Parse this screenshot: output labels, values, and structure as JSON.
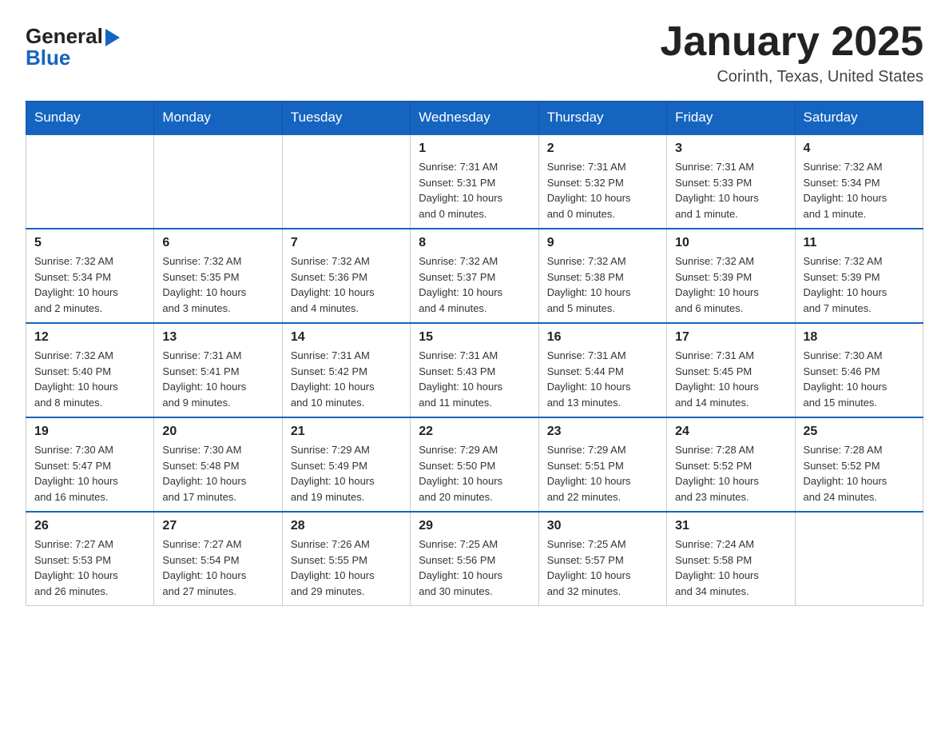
{
  "header": {
    "title": "January 2025",
    "location": "Corinth, Texas, United States"
  },
  "logo": {
    "line1": "General",
    "line2": "Blue"
  },
  "days": [
    "Sunday",
    "Monday",
    "Tuesday",
    "Wednesday",
    "Thursday",
    "Friday",
    "Saturday"
  ],
  "weeks": [
    [
      {
        "day": "",
        "sunrise": "",
        "sunset": "",
        "daylight": ""
      },
      {
        "day": "",
        "sunrise": "",
        "sunset": "",
        "daylight": ""
      },
      {
        "day": "",
        "sunrise": "",
        "sunset": "",
        "daylight": ""
      },
      {
        "day": "1",
        "sunrise": "Sunrise: 7:31 AM",
        "sunset": "Sunset: 5:31 PM",
        "daylight": "Daylight: 10 hours and 0 minutes."
      },
      {
        "day": "2",
        "sunrise": "Sunrise: 7:31 AM",
        "sunset": "Sunset: 5:32 PM",
        "daylight": "Daylight: 10 hours and 0 minutes."
      },
      {
        "day": "3",
        "sunrise": "Sunrise: 7:31 AM",
        "sunset": "Sunset: 5:33 PM",
        "daylight": "Daylight: 10 hours and 1 minute."
      },
      {
        "day": "4",
        "sunrise": "Sunrise: 7:32 AM",
        "sunset": "Sunset: 5:34 PM",
        "daylight": "Daylight: 10 hours and 1 minute."
      }
    ],
    [
      {
        "day": "5",
        "sunrise": "Sunrise: 7:32 AM",
        "sunset": "Sunset: 5:34 PM",
        "daylight": "Daylight: 10 hours and 2 minutes."
      },
      {
        "day": "6",
        "sunrise": "Sunrise: 7:32 AM",
        "sunset": "Sunset: 5:35 PM",
        "daylight": "Daylight: 10 hours and 3 minutes."
      },
      {
        "day": "7",
        "sunrise": "Sunrise: 7:32 AM",
        "sunset": "Sunset: 5:36 PM",
        "daylight": "Daylight: 10 hours and 4 minutes."
      },
      {
        "day": "8",
        "sunrise": "Sunrise: 7:32 AM",
        "sunset": "Sunset: 5:37 PM",
        "daylight": "Daylight: 10 hours and 4 minutes."
      },
      {
        "day": "9",
        "sunrise": "Sunrise: 7:32 AM",
        "sunset": "Sunset: 5:38 PM",
        "daylight": "Daylight: 10 hours and 5 minutes."
      },
      {
        "day": "10",
        "sunrise": "Sunrise: 7:32 AM",
        "sunset": "Sunset: 5:39 PM",
        "daylight": "Daylight: 10 hours and 6 minutes."
      },
      {
        "day": "11",
        "sunrise": "Sunrise: 7:32 AM",
        "sunset": "Sunset: 5:39 PM",
        "daylight": "Daylight: 10 hours and 7 minutes."
      }
    ],
    [
      {
        "day": "12",
        "sunrise": "Sunrise: 7:32 AM",
        "sunset": "Sunset: 5:40 PM",
        "daylight": "Daylight: 10 hours and 8 minutes."
      },
      {
        "day": "13",
        "sunrise": "Sunrise: 7:31 AM",
        "sunset": "Sunset: 5:41 PM",
        "daylight": "Daylight: 10 hours and 9 minutes."
      },
      {
        "day": "14",
        "sunrise": "Sunrise: 7:31 AM",
        "sunset": "Sunset: 5:42 PM",
        "daylight": "Daylight: 10 hours and 10 minutes."
      },
      {
        "day": "15",
        "sunrise": "Sunrise: 7:31 AM",
        "sunset": "Sunset: 5:43 PM",
        "daylight": "Daylight: 10 hours and 11 minutes."
      },
      {
        "day": "16",
        "sunrise": "Sunrise: 7:31 AM",
        "sunset": "Sunset: 5:44 PM",
        "daylight": "Daylight: 10 hours and 13 minutes."
      },
      {
        "day": "17",
        "sunrise": "Sunrise: 7:31 AM",
        "sunset": "Sunset: 5:45 PM",
        "daylight": "Daylight: 10 hours and 14 minutes."
      },
      {
        "day": "18",
        "sunrise": "Sunrise: 7:30 AM",
        "sunset": "Sunset: 5:46 PM",
        "daylight": "Daylight: 10 hours and 15 minutes."
      }
    ],
    [
      {
        "day": "19",
        "sunrise": "Sunrise: 7:30 AM",
        "sunset": "Sunset: 5:47 PM",
        "daylight": "Daylight: 10 hours and 16 minutes."
      },
      {
        "day": "20",
        "sunrise": "Sunrise: 7:30 AM",
        "sunset": "Sunset: 5:48 PM",
        "daylight": "Daylight: 10 hours and 17 minutes."
      },
      {
        "day": "21",
        "sunrise": "Sunrise: 7:29 AM",
        "sunset": "Sunset: 5:49 PM",
        "daylight": "Daylight: 10 hours and 19 minutes."
      },
      {
        "day": "22",
        "sunrise": "Sunrise: 7:29 AM",
        "sunset": "Sunset: 5:50 PM",
        "daylight": "Daylight: 10 hours and 20 minutes."
      },
      {
        "day": "23",
        "sunrise": "Sunrise: 7:29 AM",
        "sunset": "Sunset: 5:51 PM",
        "daylight": "Daylight: 10 hours and 22 minutes."
      },
      {
        "day": "24",
        "sunrise": "Sunrise: 7:28 AM",
        "sunset": "Sunset: 5:52 PM",
        "daylight": "Daylight: 10 hours and 23 minutes."
      },
      {
        "day": "25",
        "sunrise": "Sunrise: 7:28 AM",
        "sunset": "Sunset: 5:52 PM",
        "daylight": "Daylight: 10 hours and 24 minutes."
      }
    ],
    [
      {
        "day": "26",
        "sunrise": "Sunrise: 7:27 AM",
        "sunset": "Sunset: 5:53 PM",
        "daylight": "Daylight: 10 hours and 26 minutes."
      },
      {
        "day": "27",
        "sunrise": "Sunrise: 7:27 AM",
        "sunset": "Sunset: 5:54 PM",
        "daylight": "Daylight: 10 hours and 27 minutes."
      },
      {
        "day": "28",
        "sunrise": "Sunrise: 7:26 AM",
        "sunset": "Sunset: 5:55 PM",
        "daylight": "Daylight: 10 hours and 29 minutes."
      },
      {
        "day": "29",
        "sunrise": "Sunrise: 7:25 AM",
        "sunset": "Sunset: 5:56 PM",
        "daylight": "Daylight: 10 hours and 30 minutes."
      },
      {
        "day": "30",
        "sunrise": "Sunrise: 7:25 AM",
        "sunset": "Sunset: 5:57 PM",
        "daylight": "Daylight: 10 hours and 32 minutes."
      },
      {
        "day": "31",
        "sunrise": "Sunrise: 7:24 AM",
        "sunset": "Sunset: 5:58 PM",
        "daylight": "Daylight: 10 hours and 34 minutes."
      },
      {
        "day": "",
        "sunrise": "",
        "sunset": "",
        "daylight": ""
      }
    ]
  ]
}
